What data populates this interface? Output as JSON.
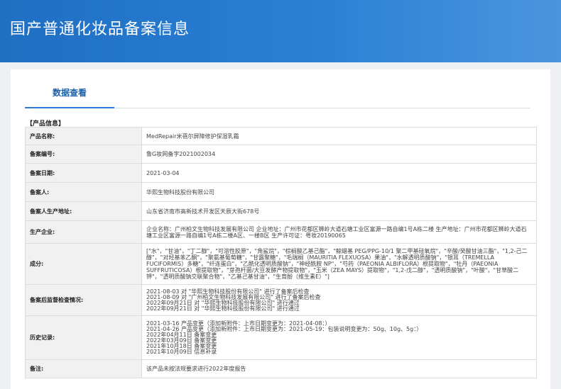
{
  "header": {
    "title": "国产普通化妆品备案信息"
  },
  "tabs": [
    {
      "label": "数据查看"
    }
  ],
  "section_title": "【产品信息】",
  "rows": [
    {
      "label": "产品名称:",
      "value": "MedRepair米蓓尔屏障修护保湿乳霜"
    },
    {
      "label": "备案编号:",
      "value": "鲁G妆网备字2021002034"
    },
    {
      "label": "备案日期:",
      "value": "2021-03-04"
    },
    {
      "label": "备案人:",
      "value": "华熙生物科技股份有限公司"
    },
    {
      "label": "备案人生产地址:",
      "value": "山东省济南市高新技术开发区天辰大街678号"
    },
    {
      "label": "生产企业:",
      "value": "企业名称：广州柏文生物科技发展有限公司 企业地址：广州市花都区狮岭大道石塘工业区富源一路自编1号A栋二楼 生产地址：广州市花都区狮岭大道石塘工业区富源一路自编1号A栋二楼A区、一楼B区 生产许可证：粤妆20190065"
    },
    {
      "label": "成分:",
      "value": "[\"水\"，\"甘油\"，\"丁二醇\"，\"可溶性胶原\"，\"角鲨烷\"，\"棕榈酸乙基己酯\"，\"鲸蜡基 PEG/PPG-10/1 聚二甲基硅氧烷\"，\"辛酸/癸酸甘油三酯\"，\"1,2-己二醇\"，\"对羟基苯乙酮\"，\"聚氨基葡萄糖\"，\"甘露聚糖\"，\"毛瑞榈（MAURITIA FLEXUOSA）果油\"，\"水解透明质酸钠\"，\"银耳（TREMELLA FUCIFORMIS）多糖\"，\"纤连蛋白\"，\"乙酰化透明质酸钠\"，\"神经酰胺 NP\"，\"芍药（PAEONIA ALBIFLORA）根提取物\"，\"牡丹（PAEONIA SUFFRUTICOSA）根提取物\"，\"芽孢杆菌/大豆发酵产物提取物\"，\"玉米（ZEA MAYS）提取物\"，\"1,2-戊二醇\"，\"透明质酸钠\"，\"叶酸\"，\"甘草酸二钾\"，\"透明质酸钠交联聚合物\"，\"乙基己基甘油\"，\"生育酚（维生素E）\"]"
    },
    {
      "label": "备案后监督检查情况:",
      "value": "2021-08-03 对 \"华熙生物科技股份有限公司\" 进行了备案后检查\n2021-08-09 对 \"广州柏文生物科技发展有限公司\" 进行了备案后检查\n2022年09月21日 对 \"华熙生物科技股份有限公司\" 进行通过\n2022年09月21日 对 \"华熙生物科技股份有限公司\" 进行通过"
    },
    {
      "label": "历史记录:",
      "value": "2021-03-16 产品变更（添加新附件：上市日期变更为：2021-04-08：）\n2021-04-26 产品变更（添加新附件：上市日期变更为：2021-05-19：包装说明变更为：50g、10g、5g：）\n2022年04月11日 备案变更\n2022年03月09日 备案变更\n2021年10月18日 备案变更\n2021年10月09日 信息补录"
    },
    {
      "label": "备注:",
      "value": "该产品未按法规要求进行2022年度报告"
    }
  ]
}
